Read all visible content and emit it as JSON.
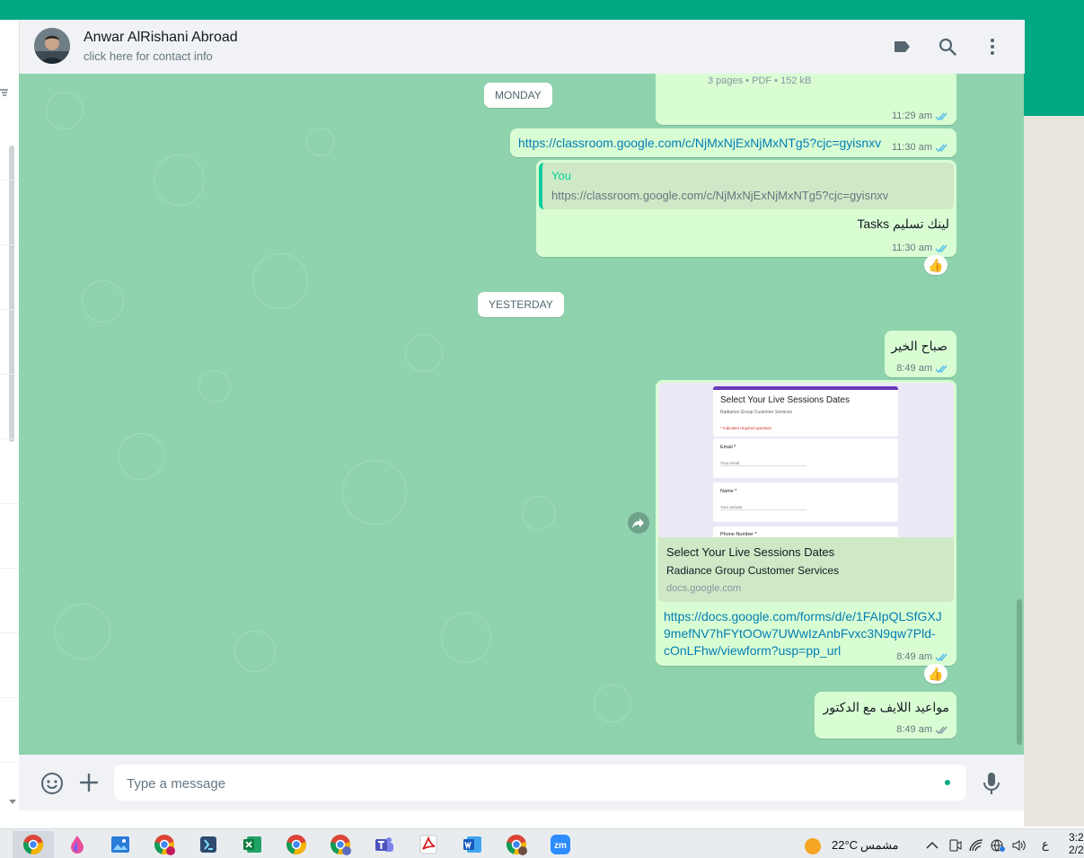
{
  "header": {
    "contact_name": "Anwar AlRishani Abroad",
    "contact_sub": "click here for contact info"
  },
  "chat": {
    "day_monday": "MONDAY",
    "day_yesterday": "YESTERDAY",
    "msg1": {
      "file_meta": "3 pages • PDF • 152 kB",
      "time": "11:29 am"
    },
    "msg2": {
      "link": "https://classroom.google.com/c/NjMxNjExNjMxNTg5?cjc=gyisnxv",
      "time": "11:30 am"
    },
    "msg3": {
      "quote_author": "You",
      "quote_text": "https://classroom.google.com/c/NjMxNjExNjMxNTg5?cjc=gyisnxv",
      "text": "لينك تسليم Tasks",
      "time": "11:30 am",
      "reaction": "👍"
    },
    "msg4": {
      "text": "صباح الخير",
      "time": "8:49 am"
    },
    "msg5": {
      "preview": {
        "form_title": "Select Your Live Sessions Dates",
        "form_org": "Radiance Group Customer Services",
        "form_required": "* Indicates required question",
        "field_email": "Email *",
        "field_email_ph": "Your email",
        "field_name": "Name *",
        "field_name_ph": "Your answer",
        "field_phone": "Phone Number *"
      },
      "title": "Select Your Live Sessions Dates",
      "description": "Radiance Group Customer Services",
      "domain": "docs.google.com",
      "link_line1": "https://docs.google.com/forms/d/e/1FAIpQLSfGXJ",
      "link_line2": "9mefNV7hFYtOOw7UWwIzAnbFvxc3N9qw7Pld-",
      "link_line3": "cOnLFhw/viewform?usp=pp_url",
      "time": "8:49 am",
      "reaction": "👍"
    },
    "msg6": {
      "text": "مواعيد اللايف مع الدكتور",
      "time": "8:49 am"
    }
  },
  "composer": {
    "placeholder": "Type a message"
  },
  "taskbar": {
    "weather_temp": "22°C",
    "weather_text": "مشمس",
    "lang": "ع",
    "clock_line1": "3:2",
    "clock_line2": "2/2"
  },
  "colors": {
    "accent": "#00a884",
    "chat_bg": "#8fd3ae",
    "outgoing_bubble": "#d9fdd3",
    "link": "#027eb5",
    "tick_read": "#53bdeb"
  }
}
